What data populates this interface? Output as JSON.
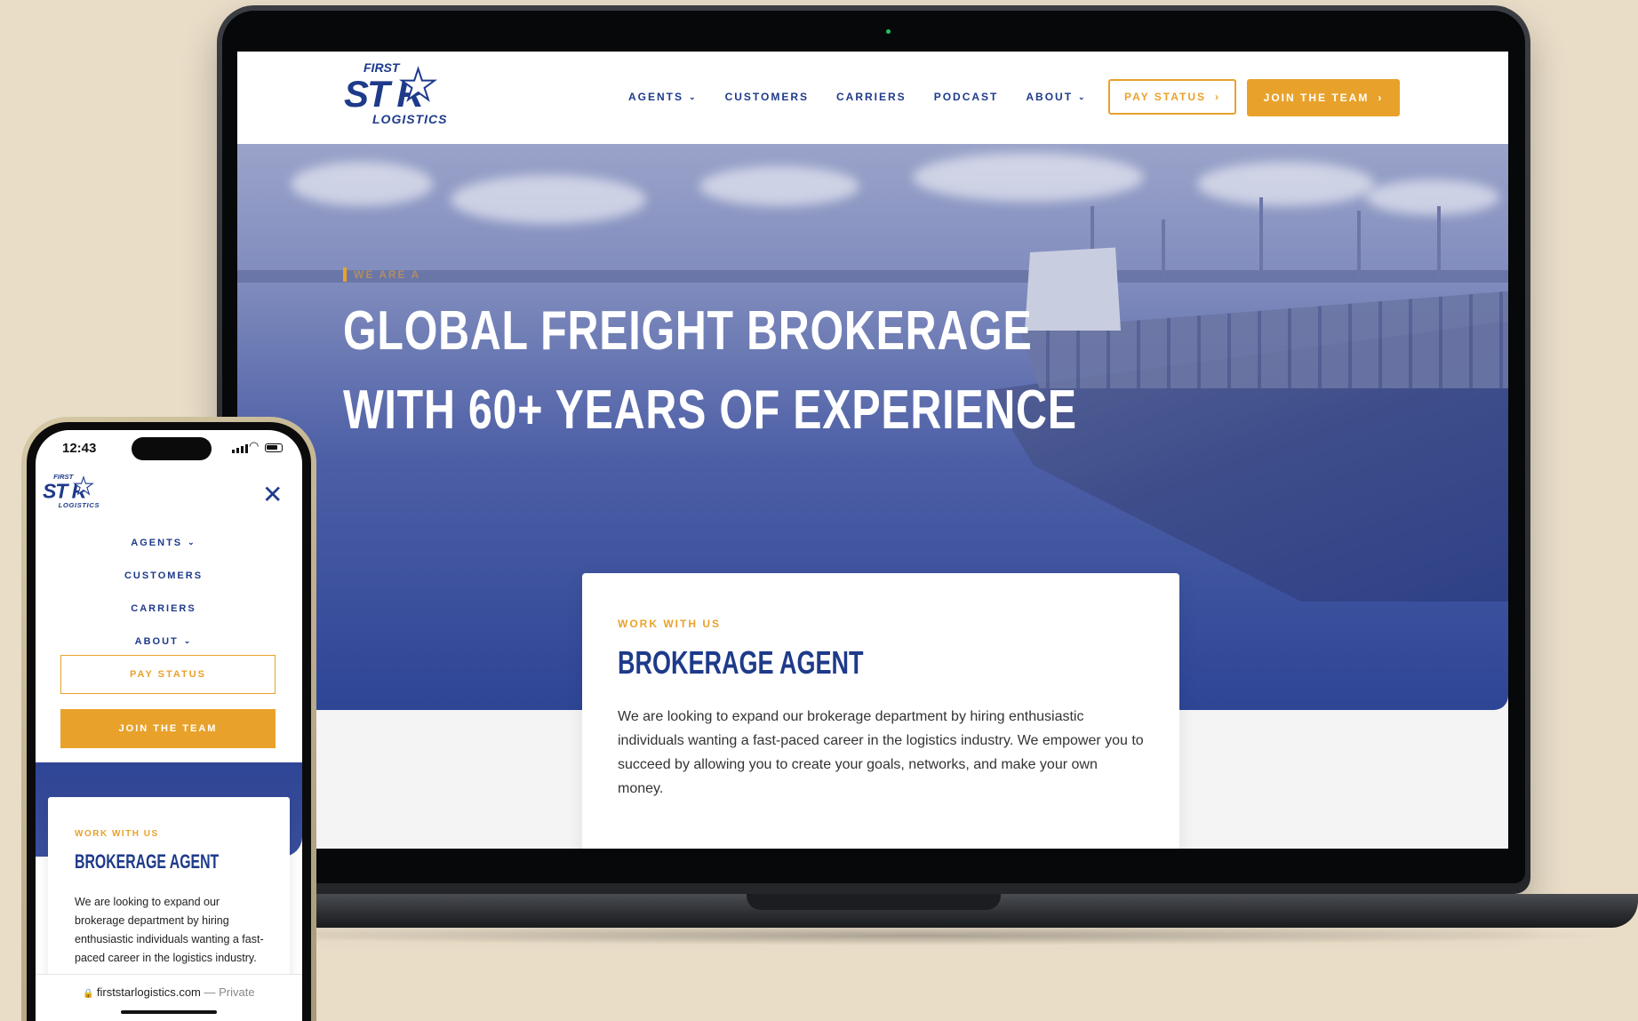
{
  "laptop": {
    "logo": {
      "top": "FIRST",
      "main": "ST R",
      "star": "★",
      "bottom": "LOGISTICS"
    },
    "nav": [
      {
        "label": "AGENTS",
        "has_dropdown": true
      },
      {
        "label": "CUSTOMERS",
        "has_dropdown": false
      },
      {
        "label": "CARRIERS",
        "has_dropdown": false
      },
      {
        "label": "PODCAST",
        "has_dropdown": false
      },
      {
        "label": "ABOUT",
        "has_dropdown": true
      }
    ],
    "pay_status": "PAY STATUS",
    "join_team": "JOIN THE TEAM",
    "hero": {
      "eyebrow": "WE ARE A",
      "title_line1": "GLOBAL FREIGHT BROKERAGE",
      "title_line2": "WITH 60+ YEARS OF EXPERIENCE"
    },
    "card": {
      "eyebrow": "WORK WITH US",
      "title": "BROKERAGE AGENT",
      "body": "We are looking to expand our brokerage department by hiring enthusiastic individuals wanting a fast-paced career in the logistics industry. We empower you to succeed by allowing you to create your goals, networks, and make your own money."
    }
  },
  "phone": {
    "time": "12:43",
    "logo": {
      "top": "FIRST",
      "main": "ST R",
      "star": "★",
      "bottom": "LOGISTICS"
    },
    "close_glyph": "✕",
    "nav": [
      {
        "label": "AGENTS",
        "has_dropdown": true
      },
      {
        "label": "CUSTOMERS",
        "has_dropdown": false
      },
      {
        "label": "CARRIERS",
        "has_dropdown": false
      },
      {
        "label": "ABOUT",
        "has_dropdown": true
      }
    ],
    "pay_status": "PAY STATUS",
    "join_team": "JOIN THE TEAM",
    "card": {
      "eyebrow": "WORK WITH US",
      "title": "BROKERAGE AGENT",
      "body": "We are looking to expand our brokerage department by hiring enthusiastic individuals wanting a fast-paced career in the logistics industry."
    },
    "url": "firststarlogistics.com",
    "url_suffix": "— Private"
  },
  "colors": {
    "brand_blue": "#1e3a8a",
    "accent_gold": "#e8a22b",
    "background": "#e9ddc8"
  },
  "icons": {
    "chevron_down": "chevron-down-icon",
    "chevron_right": "chevron-right-icon",
    "close": "close-icon",
    "lock": "lock-icon"
  }
}
